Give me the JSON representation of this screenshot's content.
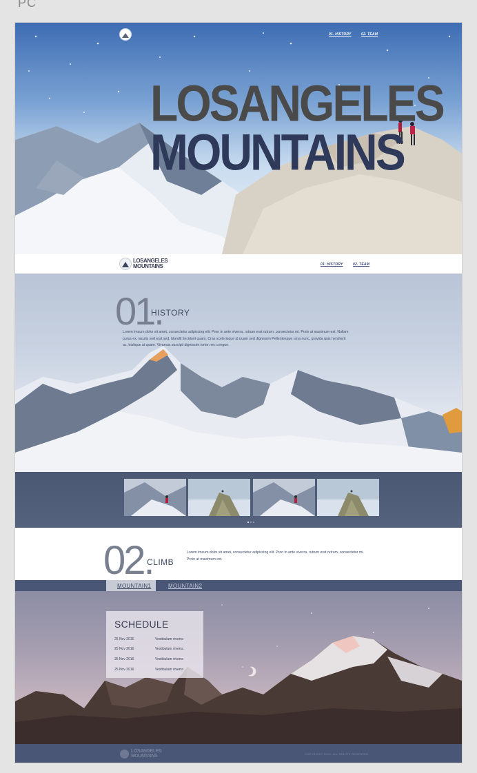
{
  "page_label": "PC",
  "nav": {
    "history": "01. HISTORY",
    "team": "02. TEAM"
  },
  "hero": {
    "title_line1": "LOSANGELES",
    "title_line2": "MOUNTAINS"
  },
  "logo": {
    "line1": "LOSANGELES",
    "line2": "MOUNTAINS"
  },
  "history": {
    "number": "01.",
    "title": "HISTORY",
    "body": "Lorem imsum dolor sit amet, consectetur adipiscing elit. Pron in ante viverra, rutrum erat rutrum, consectetur mi. Proin at maximum est. Nullam purus ex, iaculis sed erat sed, blandit tincidunt quam. Cras scelerisque id quam sed dignissim Pellentesque urna nunc, gravida quis hendrerit ac, tristique ut quam. Vivamus suscipit dignissim tortor nec congue."
  },
  "slider": {
    "slide_count": 3,
    "active_slide": 1
  },
  "climb": {
    "number": "02.",
    "title": "CLIMB",
    "body": "Lorem imsum dolor sit amet, consectetur adipiscing elit. Pron in ante viverra, rutrum erat rutrum, consectetur mi. Proin at maximum est.",
    "tabs": [
      "MOUNTAIN1",
      "MOUNTAIN2"
    ],
    "active_tab": 0
  },
  "schedule": {
    "title": "SCHEDULE",
    "rows": [
      {
        "date": "25 Nov 2016",
        "event": "Vestibulum viverra"
      },
      {
        "date": "25 Nov 2016",
        "event": "Vestibulum viverra"
      },
      {
        "date": "25 Nov 2016",
        "event": "Vestibulum viverra"
      },
      {
        "date": "25 Nov 2016",
        "event": "Vestibulum viverra"
      }
    ]
  },
  "footer": {
    "copyright": "COPYRIGHT 2016. ALL RIGHTS RESERVED."
  },
  "colors": {
    "navy": "#4a5676",
    "title_gray": "#4a4a4a",
    "title_navy": "#2f3a5a",
    "background": "#e4e4e4"
  },
  "icons": [
    "logo-mountain-icon"
  ]
}
